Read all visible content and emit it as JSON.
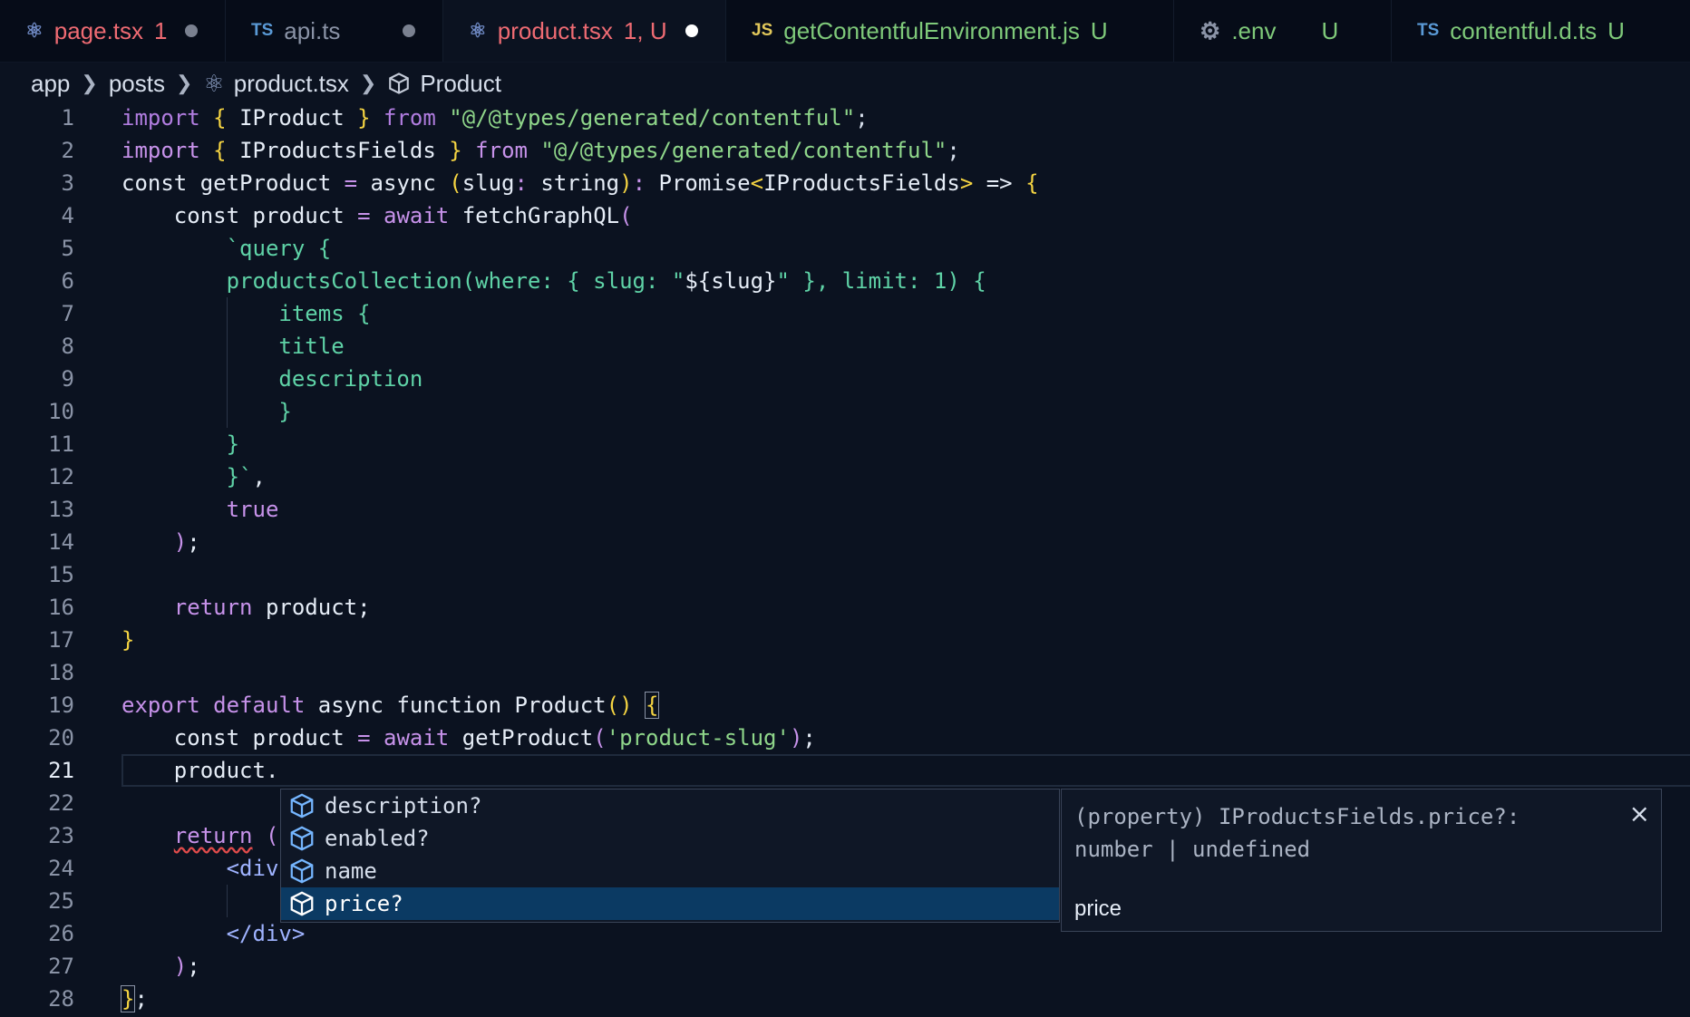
{
  "tabs": [
    {
      "name": "page.tsx",
      "status": "1",
      "icon": "react-icon",
      "modified_dot": true
    },
    {
      "name": "api.ts",
      "status": "",
      "icon": "ts-icon",
      "icon_text": "TS",
      "modified_dot": true
    },
    {
      "name": "product.tsx",
      "status": "1, U",
      "icon": "react-icon",
      "modified_dot": true,
      "active": true
    },
    {
      "name": "getContentfulEnvironment.js",
      "status": "U",
      "icon": "js-icon",
      "icon_text": "JS"
    },
    {
      "name": ".env",
      "status": "U",
      "icon": "gear-icon"
    },
    {
      "name": "contentful.d.ts",
      "status": "U",
      "icon": "ts-icon",
      "icon_text": "TS"
    }
  ],
  "breadcrumb": {
    "items": [
      "app",
      "posts",
      "product.tsx",
      "Product"
    ]
  },
  "editor": {
    "current_line": 21,
    "line_numbers": [
      "1",
      "2",
      "3",
      "4",
      "5",
      "6",
      "7",
      "8",
      "9",
      "10",
      "11",
      "12",
      "13",
      "14",
      "15",
      "16",
      "17",
      "18",
      "19",
      "20",
      "21",
      "22",
      "23",
      "24",
      "25",
      "26",
      "27",
      "28"
    ]
  },
  "suggest": {
    "items": [
      "description?",
      "enabled?",
      "name",
      "price?"
    ],
    "selected_index": 3
  },
  "details": {
    "signature": "(property) IProductsFields.price?: number | undefined",
    "doc": "price",
    "close": "×"
  },
  "colors": {
    "background": "#0b1220",
    "tabbar": "#060c18",
    "selection": "#0b3a63",
    "keyword": "#c792ea",
    "string": "#8fd68a",
    "bracket": "#f5d442",
    "error": "#ef6b73"
  }
}
